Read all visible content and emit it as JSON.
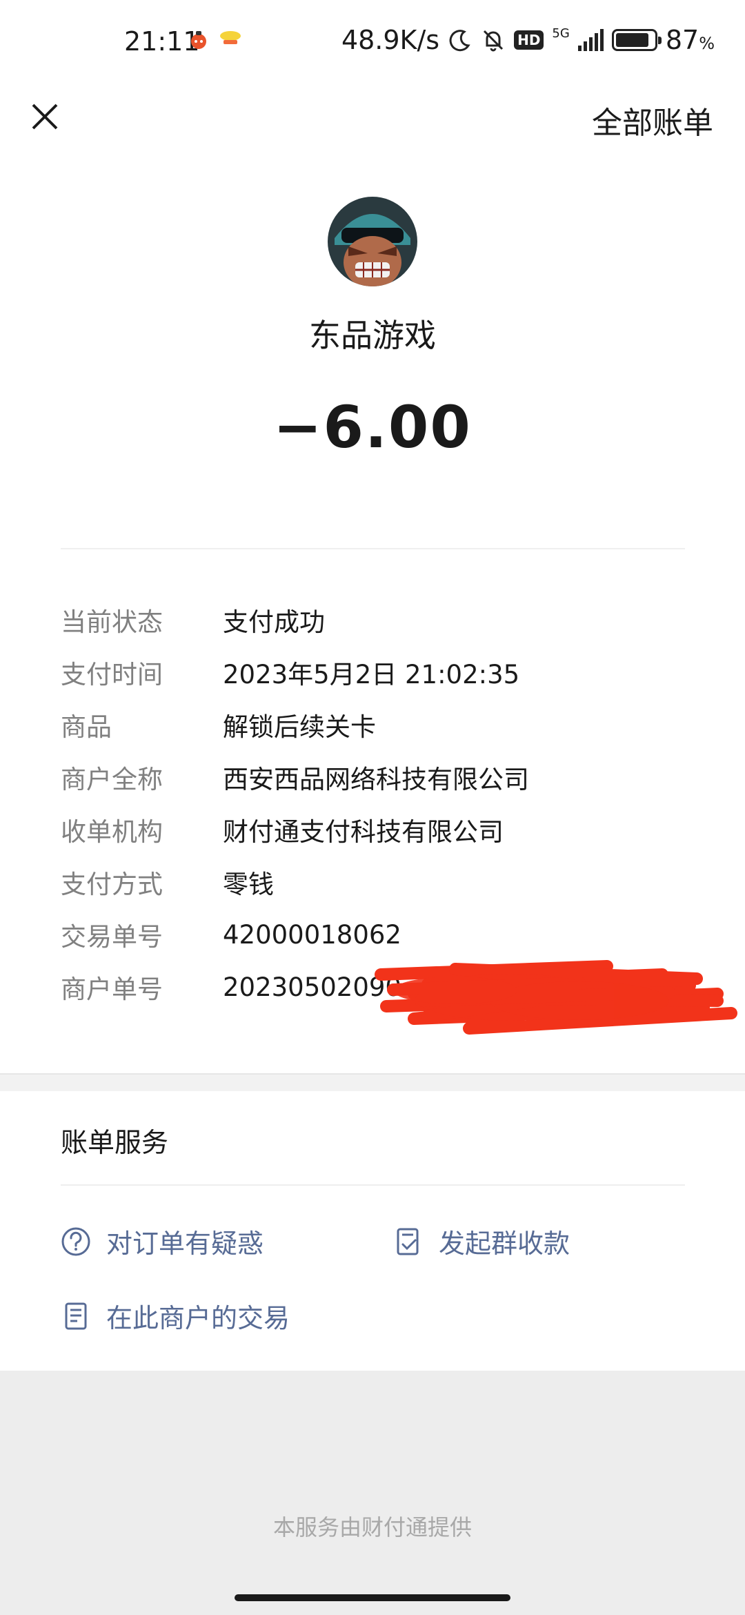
{
  "status_bar": {
    "time": "21:11",
    "net_speed": "48.9K/s",
    "hd": "HD",
    "network": "5G",
    "battery_percent": "87",
    "battery_unit": "%",
    "battery_level": 0.87
  },
  "nav": {
    "close_icon": "close-icon",
    "all_bills": "全部账单"
  },
  "merchant": {
    "avatar_icon": "game-character-avatar",
    "name": "东品游戏",
    "amount": "−6.00"
  },
  "details": [
    {
      "label": "当前状态",
      "value": "支付成功"
    },
    {
      "label": "支付时间",
      "value": "2023年5月2日 21:02:35"
    },
    {
      "label": "商品",
      "value": "解锁后续关卡"
    },
    {
      "label": "商户全称",
      "value": "西安西品网络科技有限公司"
    },
    {
      "label": "收单机构",
      "value": "财付通支付科技有限公司"
    },
    {
      "label": "支付方式",
      "value": "零钱"
    },
    {
      "label": "交易单号",
      "value": "42000018062"
    },
    {
      "label": "商户单号",
      "value": "20230502090"
    }
  ],
  "services": {
    "title": "账单服务",
    "items": [
      {
        "label": "对订单有疑惑",
        "icon": "question-circle-icon"
      },
      {
        "label": "发起群收款",
        "icon": "group-collect-icon"
      },
      {
        "label": "在此商户的交易",
        "icon": "document-list-icon"
      }
    ]
  },
  "footer": {
    "note": "本服务由财付通提供"
  },
  "colors": {
    "link": "#576b95",
    "label_gray": "#808080",
    "redaction": "#f2331a"
  }
}
